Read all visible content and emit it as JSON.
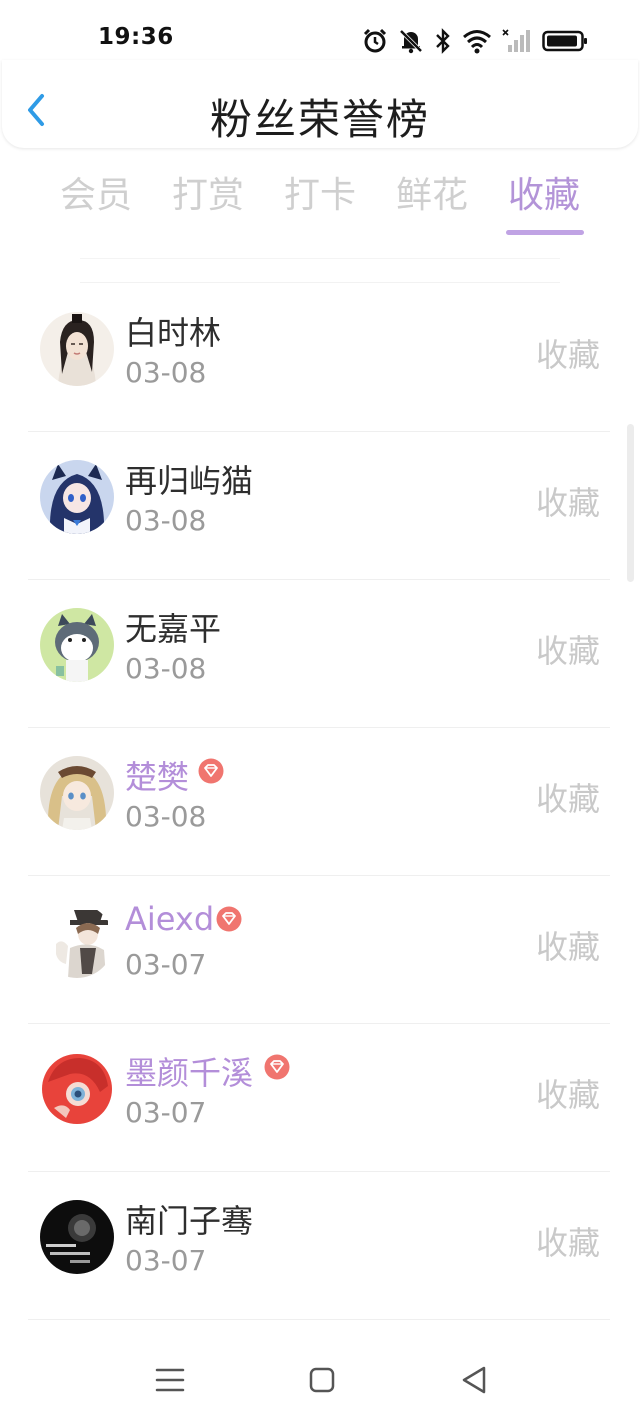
{
  "status_bar": {
    "time": "19:36",
    "icons": [
      "alarm-icon",
      "mute-bell-icon",
      "bluetooth-icon",
      "wifi-icon",
      "cellular-signal-icon",
      "battery-icon"
    ]
  },
  "header": {
    "title": "粉丝荣誉榜",
    "back_icon": "chevron-left-icon"
  },
  "tabs": [
    {
      "label": "会员",
      "active": false
    },
    {
      "label": "打赏",
      "active": false
    },
    {
      "label": "打卡",
      "active": false
    },
    {
      "label": "鲜花",
      "active": false
    },
    {
      "label": "收藏",
      "active": true
    }
  ],
  "colors": {
    "accent": "#b394d8",
    "vip_name": "#b38ed9",
    "vip_badge": "#f0756f",
    "inactive_tab": "#cfcfcf",
    "action_text": "#c9c9c9"
  },
  "fans": [
    {
      "name": "白时林",
      "date": "03-08",
      "action": "收藏",
      "vip": false,
      "avatar": "ancient-style-portrait"
    },
    {
      "name": "再归屿猫",
      "date": "03-08",
      "action": "收藏",
      "vip": false,
      "avatar": "anime-girl-blue"
    },
    {
      "name": "无嘉平",
      "date": "03-08",
      "action": "收藏",
      "vip": false,
      "avatar": "cartoon-dog-green"
    },
    {
      "name": "楚樊",
      "date": "03-08",
      "action": "收藏",
      "vip": true,
      "avatar": "anime-girl-blonde"
    },
    {
      "name": "Aiexd",
      "date": "03-07",
      "action": "收藏",
      "vip": true,
      "avatar": "anime-character-hat"
    },
    {
      "name": "墨颜千溪",
      "date": "03-07",
      "action": "收藏",
      "vip": true,
      "avatar": "red-anime-girl"
    },
    {
      "name": "南门子骞",
      "date": "03-07",
      "action": "收藏",
      "vip": false,
      "avatar": "dark-text-avatar"
    }
  ],
  "nav_bar": {
    "icons": [
      "menu-icon",
      "home-square-icon",
      "back-triangle-icon"
    ]
  }
}
